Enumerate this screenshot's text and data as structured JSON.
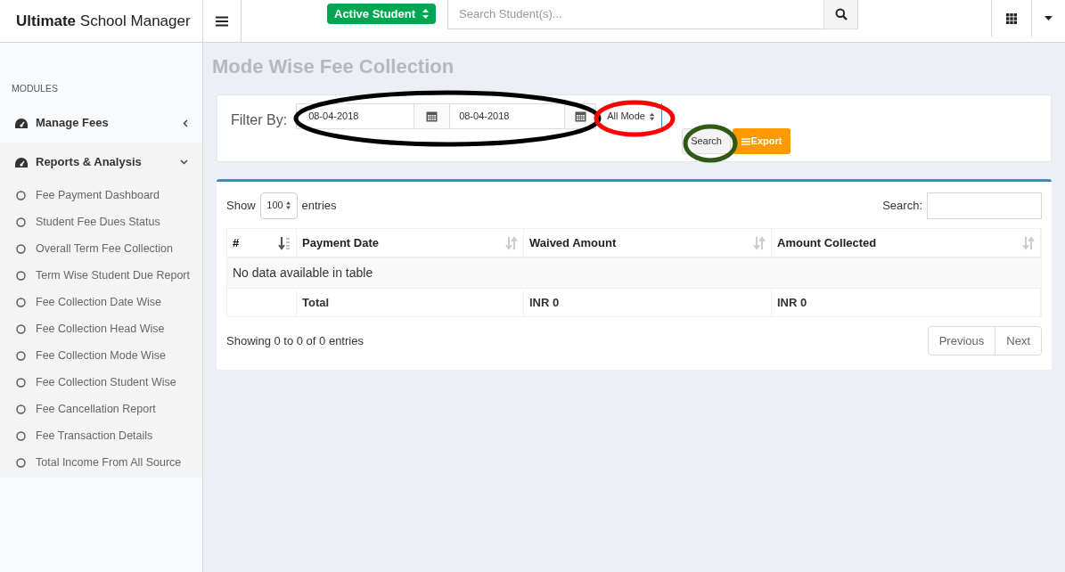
{
  "header": {
    "brand_bold": "Ultimate",
    "brand_rest": "School Manager",
    "student_filter": "Active Student",
    "search": {
      "placeholder": "Search Student(s)..."
    }
  },
  "sidebar": {
    "section": "MODULES",
    "items": [
      {
        "label": "Manage Fees",
        "expanded": false
      },
      {
        "label": "Reports & Analysis",
        "expanded": true,
        "children": [
          {
            "label": "Fee Payment Dashboard"
          },
          {
            "label": "Student Fee Dues Status"
          },
          {
            "label": "Overall Term Fee Collection"
          },
          {
            "label": "Term Wise Student Due Report"
          },
          {
            "label": "Fee Collection Date Wise"
          },
          {
            "label": "Fee Collection Head Wise"
          },
          {
            "label": "Fee Collection Mode Wise"
          },
          {
            "label": "Fee Collection Student Wise"
          },
          {
            "label": "Fee Cancellation Report"
          },
          {
            "label": "Fee Transaction Details"
          },
          {
            "label": "Total Income From All Source"
          }
        ]
      }
    ]
  },
  "page_title": "Mode Wise Fee Collection",
  "filter": {
    "label": "Filter By:",
    "date_from": "08-04-2018",
    "date_to": "08-04-2018",
    "mode": "All Mode",
    "buttons": [
      "Search",
      "Export"
    ]
  },
  "table": {
    "show_label": "Show",
    "page_size": "100",
    "entries_label": "entries",
    "search_label": "Search:",
    "columns": [
      {
        "label": "#",
        "sorted": true
      },
      {
        "label": "Payment Date",
        "sorted": false
      },
      {
        "label": "Waived Amount",
        "sorted": false
      },
      {
        "label": "Amount Collected",
        "sorted": false
      }
    ],
    "empty_message": "No data available in table",
    "footer": [
      "Total",
      "INR 0",
      "INR 0"
    ],
    "info": "Showing 0 to 0 of 0 entries",
    "pagination": [
      "Previous",
      "Next"
    ]
  },
  "annotations": [
    {
      "color": "#000000"
    },
    {
      "color": "#ff0000"
    },
    {
      "color": "#2f5a16"
    }
  ]
}
